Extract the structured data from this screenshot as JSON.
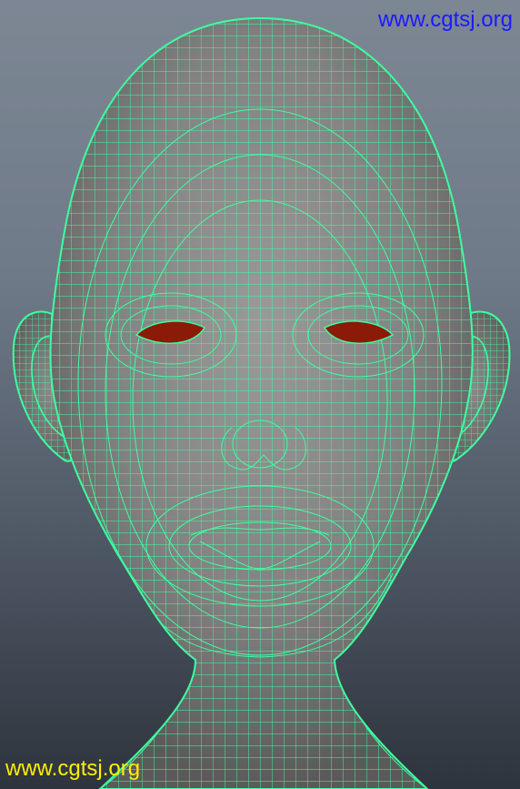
{
  "viewport": {
    "subject": "head-wireframe-model",
    "colors": {
      "background_top": "#7d8794",
      "background_bottom": "#2e343d",
      "skin": "#8a8a8a",
      "wireframe": "#3dffa0",
      "eyes": "#8c1a08"
    }
  },
  "watermarks": {
    "top": {
      "text": "www.cgtsj.org",
      "color": "#1a1aff"
    },
    "bottom": {
      "text": "www.cgtsj.org",
      "color": "#ffee00"
    }
  }
}
